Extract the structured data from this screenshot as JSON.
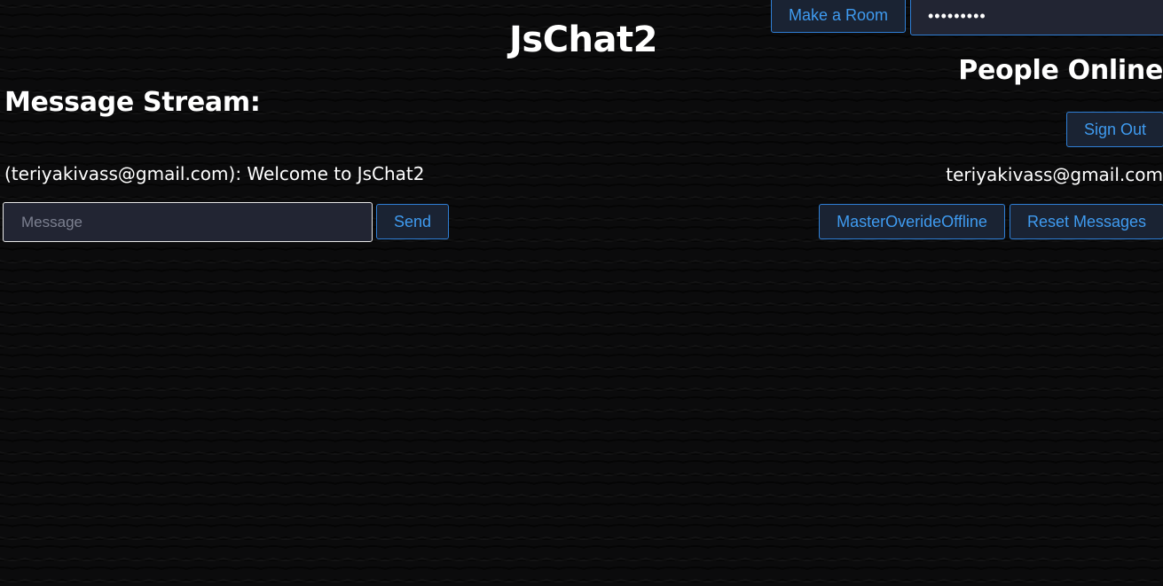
{
  "app": {
    "title": "JsChat2"
  },
  "toolbar": {
    "make_room_label": "Make a Room",
    "room_password_value": "•••••••••"
  },
  "stream": {
    "heading": "Message Stream:",
    "messages": [
      {
        "text": "(teriyakivass@gmail.com): Welcome to JsChat2"
      }
    ],
    "input_placeholder": "Message",
    "send_label": "Send"
  },
  "sidebar": {
    "heading": "People Online",
    "sign_out_label": "Sign Out",
    "users": [
      {
        "email": "teriyakivass@gmail.com"
      }
    ],
    "override_label": "MasterOverideOffline",
    "reset_label": "Reset Messages"
  },
  "colors": {
    "accent": "#3f9bf0",
    "button_border": "#2f7fd6",
    "button_bg": "#1a2333",
    "background": "#0b0b0c",
    "text": "#ffffff"
  }
}
